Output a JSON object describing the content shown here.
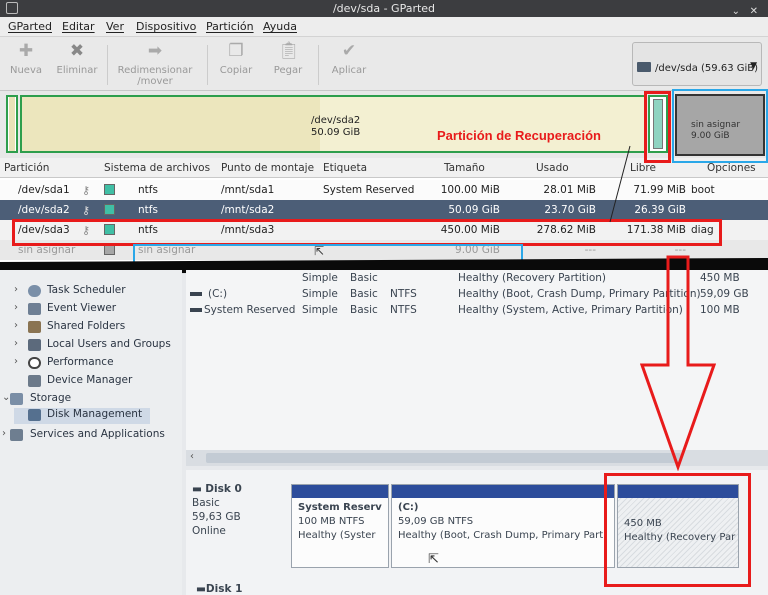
{
  "window": {
    "title": "/dev/sda - GParted"
  },
  "menu": [
    "GParted",
    "Editar",
    "Ver",
    "Dispositivo",
    "Partición",
    "Ayuda"
  ],
  "toolbar": {
    "new": "Nueva",
    "delete": "Eliminar",
    "resize_l1": "Redimensionar",
    "resize_l2": "/mover",
    "copy": "Copiar",
    "paste": "Pegar",
    "apply": "Aplicar"
  },
  "device_selector": "/dev/sda  (59.63 GiB)",
  "diskmap": {
    "sda2_name": "/dev/sda2",
    "sda2_size": "50.09 GiB",
    "unalloc_name": "sin asignar",
    "unalloc_size": "9.00 GiB"
  },
  "annotation": "Partición de Recuperación",
  "table": {
    "headers": [
      "Partición",
      "Sistema de archivos",
      "Punto de montaje",
      "Etiqueta",
      "Tamaño",
      "Usado",
      "Libre",
      "Opciones"
    ],
    "rows": [
      {
        "partition": "/dev/sda1",
        "fs": "ntfs",
        "mount": "/mnt/sda1",
        "label": "System Reserved",
        "size": "100.00 MiB",
        "used": "28.01 MiB",
        "free": "71.99 MiB",
        "flags": "boot"
      },
      {
        "partition": "/dev/sda2",
        "fs": "ntfs",
        "mount": "/mnt/sda2",
        "label": "",
        "size": "50.09 GiB",
        "used": "23.70 GiB",
        "free": "26.39 GiB",
        "flags": ""
      },
      {
        "partition": "/dev/sda3",
        "fs": "ntfs",
        "mount": "/mnt/sda3",
        "label": "",
        "size": "450.00 MiB",
        "used": "278.62 MiB",
        "free": "171.38 MiB",
        "flags": "diag"
      },
      {
        "partition": "sin asignar",
        "fs": "sin asignar",
        "mount": "",
        "label": "",
        "size": "9.00 GiB",
        "used": "---",
        "free": "---",
        "flags": ""
      }
    ]
  },
  "tree": [
    "Task Scheduler",
    "Event Viewer",
    "Shared Folders",
    "Local Users and Groups",
    "Performance",
    "Device Manager",
    "Storage",
    "Disk Management",
    "Services and Applications"
  ],
  "volumes": [
    {
      "name": "",
      "layout": "Simple",
      "type": "Basic",
      "fs": "",
      "status": "Healthy (Recovery Partition)",
      "capacity": "450 MB"
    },
    {
      "name": "(C:)",
      "layout": "Simple",
      "type": "Basic",
      "fs": "NTFS",
      "status": "Healthy (Boot, Crash Dump, Primary Partition)",
      "capacity": "59,09 GB"
    },
    {
      "name": "System Reserved",
      "layout": "Simple",
      "type": "Basic",
      "fs": "NTFS",
      "status": "Healthy (System, Active, Primary Partition)",
      "capacity": "100 MB"
    }
  ],
  "disk0": {
    "title": "Disk 0",
    "type": "Basic",
    "size": "59,63 GB",
    "state": "Online",
    "p1_name": "System Reserv",
    "p1_size": "100 MB NTFS",
    "p1_status": "Healthy (Syster",
    "p2_name": "(C:)",
    "p2_size": "59,09 GB NTFS",
    "p2_status": "Healthy (Boot, Crash Dump, Primary Parti",
    "p3_size": "450 MB",
    "p3_status": "Healthy (Recovery Par"
  },
  "disk1": {
    "title": "Disk 1"
  },
  "colors": {
    "highlight_row": "#4c5e77",
    "annotation_red": "#e81b1b",
    "annotation_blue": "#2aa7e8",
    "partition_green": "#2e9e4c",
    "ntfs_swatch": "#40bfa5"
  }
}
